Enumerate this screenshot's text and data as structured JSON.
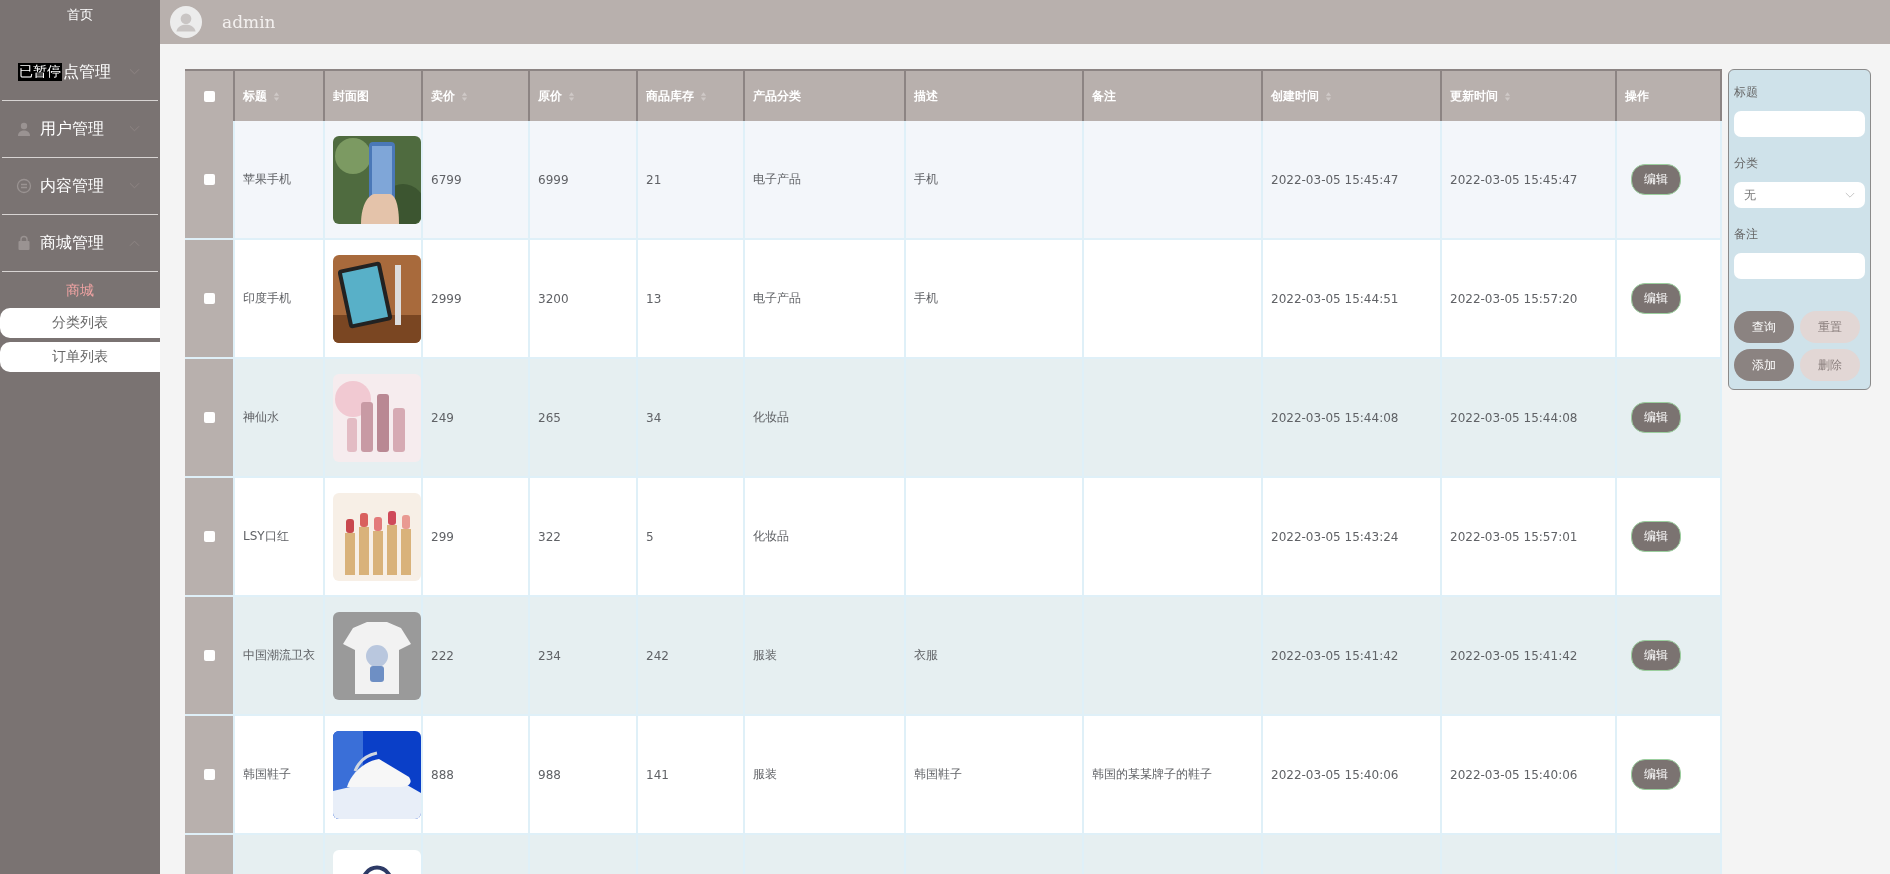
{
  "sidebar": {
    "home": "首页",
    "overlay": "已暂停",
    "menus": [
      {
        "label": "点管理",
        "expanded": false
      },
      {
        "label": "用户管理",
        "expanded": false
      },
      {
        "label": "内容管理",
        "expanded": false
      },
      {
        "label": "商城管理",
        "expanded": true,
        "group": "商城",
        "children": [
          {
            "label": "分类列表"
          },
          {
            "label": "订单列表"
          }
        ]
      }
    ]
  },
  "header": {
    "user": "admin"
  },
  "table": {
    "select_all": {
      "checked": false
    },
    "columns": [
      {
        "label": "标题",
        "sortable": true
      },
      {
        "label": "封面图",
        "sortable": false
      },
      {
        "label": "卖价",
        "sortable": true
      },
      {
        "label": "原价",
        "sortable": true
      },
      {
        "label": "商品库存",
        "sortable": true
      },
      {
        "label": "产品分类",
        "sortable": false
      },
      {
        "label": "描述",
        "sortable": false
      },
      {
        "label": "备注",
        "sortable": false
      },
      {
        "label": "创建时间",
        "sortable": true
      },
      {
        "label": "更新时间",
        "sortable": true
      },
      {
        "label": "操作",
        "sortable": false
      }
    ],
    "rows": [
      {
        "checked": false,
        "hovered": true,
        "title": "苹果手机",
        "price": "6799",
        "original_price": "6999",
        "stock": "21",
        "category": "电子产品",
        "description": "手机",
        "created": "2022-03-05 15:45:47",
        "updated": "2022-03-05 15:45:47",
        "action": "编辑"
      },
      {
        "checked": false,
        "hovered": false,
        "title": "印度手机",
        "price": "2999",
        "original_price": "3200",
        "stock": "13",
        "category": "电子产品",
        "description": "手机",
        "created": "2022-03-05 15:44:51",
        "updated": "2022-03-05 15:57:20",
        "action": "编辑"
      },
      {
        "checked": false,
        "hovered": false,
        "title": "神仙水",
        "price": "249",
        "original_price": "265",
        "stock": "34",
        "category": "化妆品",
        "created": "2022-03-05 15:44:08",
        "updated": "2022-03-05 15:44:08",
        "action": "编辑"
      },
      {
        "checked": false,
        "hovered": false,
        "title": "LSY口红",
        "price": "299",
        "original_price": "322",
        "stock": "5",
        "category": "化妆品",
        "created": "2022-03-05 15:43:24",
        "updated": "2022-03-05 15:57:01",
        "action": "编辑"
      },
      {
        "checked": false,
        "hovered": false,
        "title": "中国潮流卫衣",
        "price": "222",
        "original_price": "234",
        "stock": "242",
        "category": "服装",
        "description": "衣服",
        "created": "2022-03-05 15:41:42",
        "updated": "2022-03-05 15:41:42",
        "action": "编辑"
      },
      {
        "checked": false,
        "hovered": false,
        "title": "韩国鞋子",
        "price": "888",
        "original_price": "988",
        "stock": "141",
        "category": "服装",
        "description": "韩国鞋子",
        "note": "韩国的某某牌子的鞋子",
        "created": "2022-03-05 15:40:06",
        "updated": "2022-03-05 15:40:06",
        "action": "编辑"
      },
      {
        "hovered": false
      }
    ]
  },
  "filter": {
    "fields": [
      {
        "label": "标题",
        "kind": "input"
      },
      {
        "label": "分类",
        "kind": "select",
        "value": "无"
      },
      {
        "label": "备注",
        "kind": "input"
      }
    ],
    "buttons": [
      {
        "label": "查询",
        "disabled": false
      },
      {
        "label": "重置",
        "disabled": true
      },
      {
        "label": "添加",
        "disabled": false
      },
      {
        "label": "删除",
        "disabled": true
      }
    ]
  }
}
